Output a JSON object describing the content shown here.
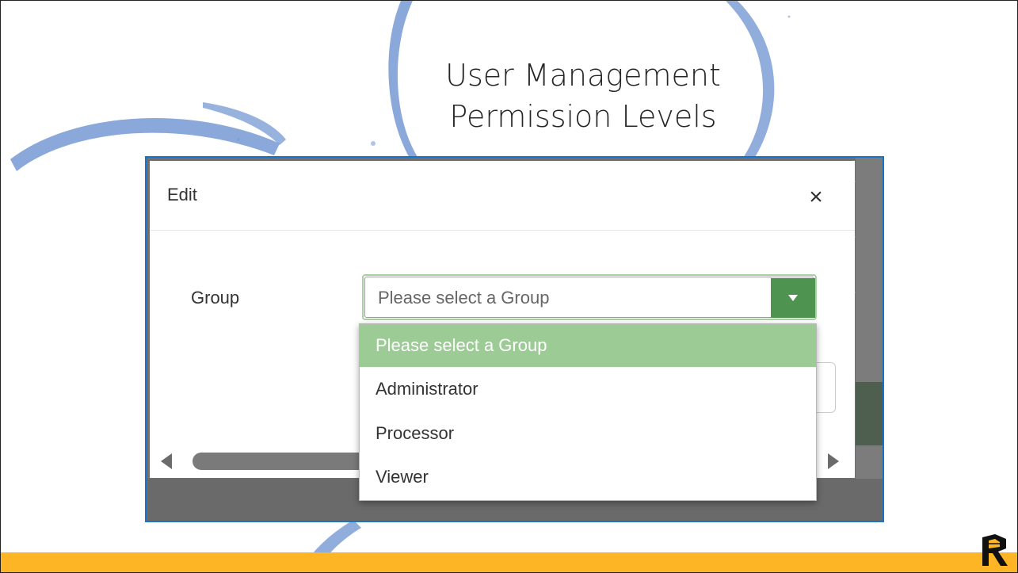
{
  "slide": {
    "title_line1": "User Management",
    "title_line2": "Permission Levels"
  },
  "modal": {
    "title": "Edit",
    "close_glyph": "×",
    "group_label": "Group",
    "select_value": "Please select a Group"
  },
  "dropdown": {
    "options": [
      {
        "label": "Please select a Group",
        "selected": true
      },
      {
        "label": "Administrator",
        "selected": false
      },
      {
        "label": "Processor",
        "selected": false
      },
      {
        "label": "Viewer",
        "selected": false
      }
    ]
  },
  "colors": {
    "accent_green": "#4f9350",
    "selected_option": "#9ccb96",
    "frame_blue": "#1b73c4",
    "footer_gold": "#fdb525",
    "decor_blue": "#7e9fd6"
  },
  "icons": [
    "close-icon",
    "dropdown-arrow-icon",
    "scroll-left-icon",
    "scroll-right-icon",
    "brand-logo-icon"
  ]
}
